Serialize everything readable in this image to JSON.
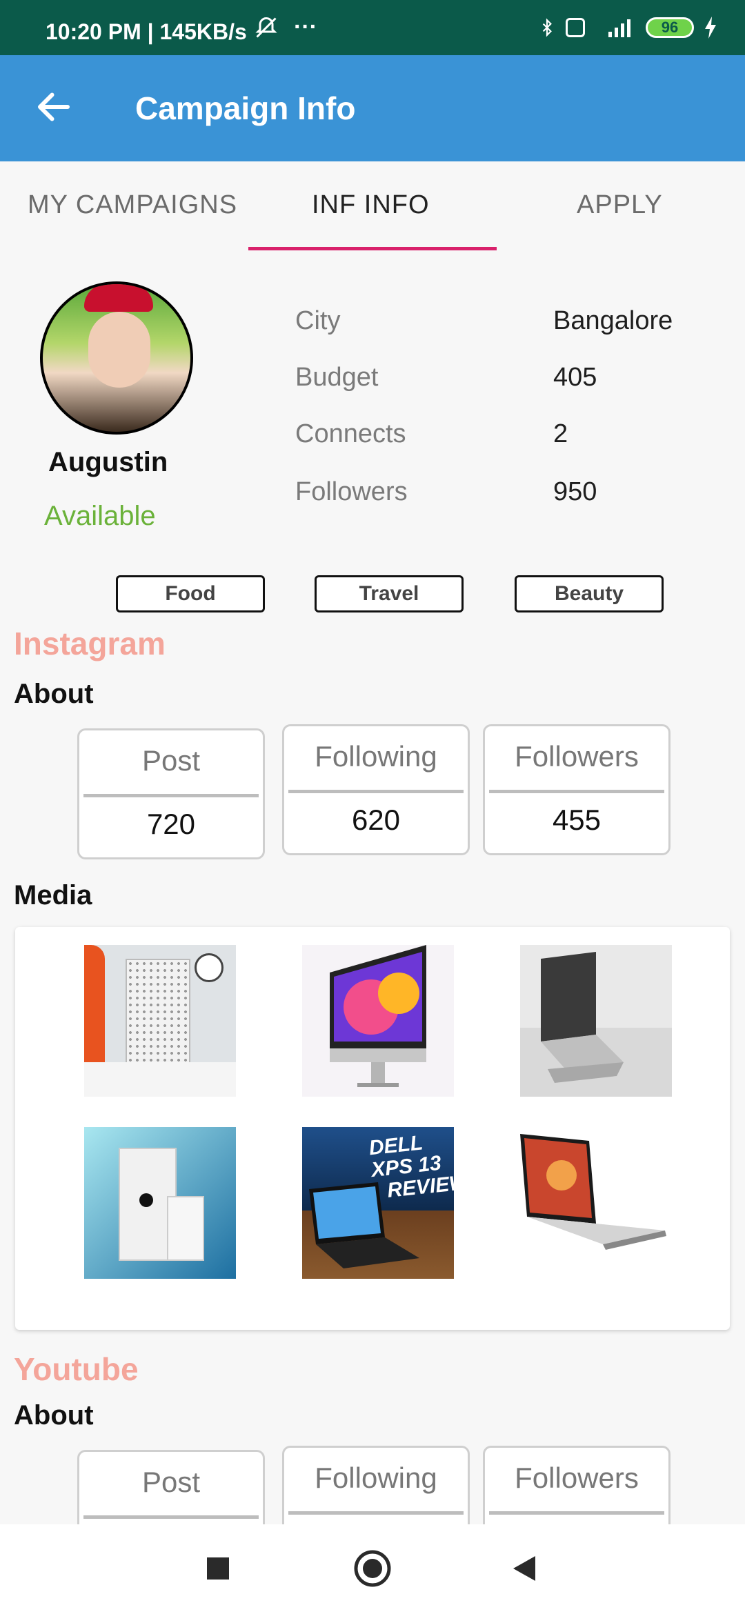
{
  "status": {
    "time": "10:20 PM | 145KB/s",
    "battery": "96"
  },
  "header": {
    "title": "Campaign Info"
  },
  "tabs": [
    {
      "label": "MY CAMPAIGNS"
    },
    {
      "label": "INF INFO"
    },
    {
      "label": "APPLY"
    }
  ],
  "profile": {
    "name": "Augustin",
    "status": "Available",
    "details": [
      {
        "label": "City",
        "value": "Bangalore"
      },
      {
        "label": "Budget",
        "value": "405"
      },
      {
        "label": "Connects",
        "value": "2"
      },
      {
        "label": "Followers",
        "value": "950"
      }
    ],
    "tags": [
      "Food",
      "Travel",
      "Beauty"
    ]
  },
  "instagram": {
    "title": "Instagram",
    "about_label": "About",
    "stats": [
      {
        "label": "Post",
        "value": "720"
      },
      {
        "label": "Following",
        "value": "620"
      },
      {
        "label": "Followers",
        "value": "455"
      }
    ],
    "media_label": "Media"
  },
  "youtube": {
    "title": "Youtube",
    "about_label": "About",
    "stats": [
      {
        "label": "Post"
      },
      {
        "label": "Following"
      },
      {
        "label": "Followers"
      }
    ]
  },
  "media_thumb_text": {
    "dell_line1": "DELL XPS 13",
    "dell_line2": "REVIEW"
  },
  "colors": {
    "status_bar": "#0b5a4a",
    "app_bar": "#3a93d6",
    "tab_indicator": "#d9216b",
    "section_title": "#f4a59a",
    "available": "#6bb23a"
  }
}
